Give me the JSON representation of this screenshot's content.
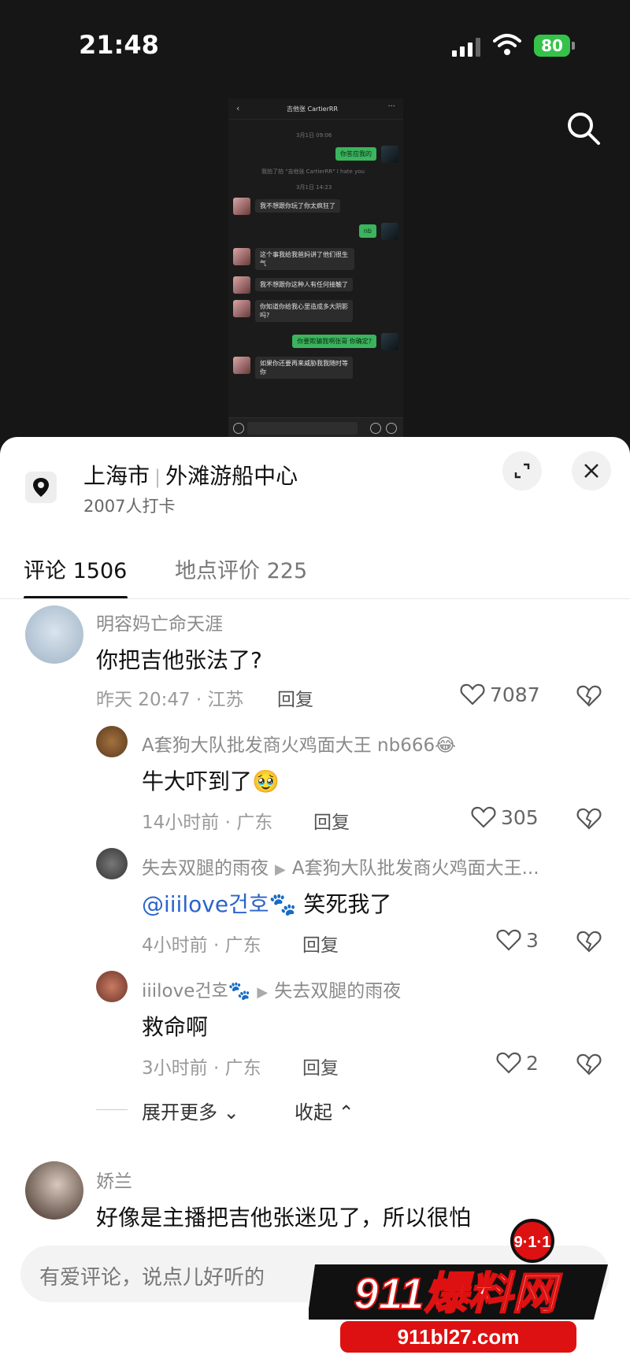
{
  "status_bar": {
    "time": "21:48",
    "battery": "80"
  },
  "chat_screenshot": {
    "title": "吉他张 CartierRR",
    "timestamp1": "3月1日 09:06",
    "me_msg1": "你答应我的",
    "system_msg": "我拍了拍 \"吉他张 CartierRR\" I hate you",
    "timestamp2": "3月1日 14:23",
    "them_msg1": "我不想跟你玩了你太疯狂了",
    "me_msg2": "nb",
    "them_msg2": "这个事我给我爸妈讲了他们很生气",
    "them_msg3": "我不想跟你这种人有任何接触了",
    "them_msg4": "你知道你给我心里造成多大阴影吗?",
    "me_msg3": "你要欺骗我啊张哥 你确定?",
    "them_msg5": "如果你还要再来威胁我我随时等你"
  },
  "location": {
    "city": "上海市",
    "place": "外滩游船中心",
    "checkins": "2007人打卡"
  },
  "tabs": {
    "comments": "评论 1506",
    "reviews": "地点评价 225"
  },
  "comments": [
    {
      "user": "明容妈亡命天涯",
      "text": "你把吉他张法了?",
      "time": "昨天 20:47 · 江苏",
      "reply": "回复",
      "likes": "7087"
    },
    {
      "user": "A套狗大队批发商火鸡面大王 nb666",
      "emoji": "😂",
      "text": "牛大吓到了",
      "text_emoji": "🥹",
      "time": "14小时前 · 广东",
      "reply": "回复",
      "likes": "305"
    },
    {
      "user": "失去双腿的雨夜",
      "reply_to": "A套狗大队批发商火鸡面大王...",
      "mention": "@iiilove건호🐾",
      "text": "笑死我了",
      "time": "4小时前 · 广东",
      "reply": "回复",
      "likes": "3"
    },
    {
      "user": "iiilove건호🐾",
      "reply_to": "失去双腿的雨夜",
      "text": "救命啊",
      "time": "3小时前 · 广东",
      "reply": "回复",
      "likes": "2"
    },
    {
      "user": "娇兰",
      "text": "好像是主播把吉他张迷见了，所以很怕"
    }
  ],
  "expand_more": "展开更多",
  "collapse": "收起",
  "input_placeholder": "有爱评论，说点儿好听的",
  "watermark": {
    "badge": "9·1·1",
    "brand": "911爆料网",
    "url": "911bl27.com"
  }
}
